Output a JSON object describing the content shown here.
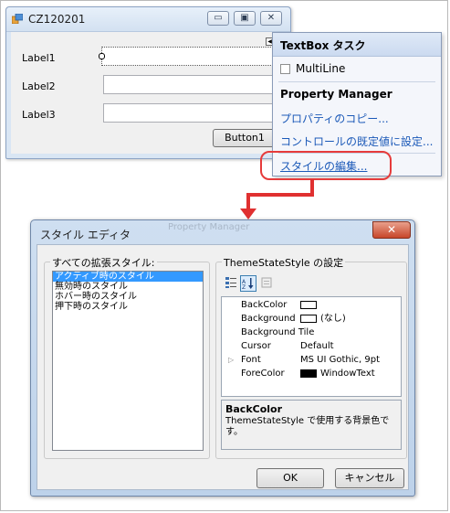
{
  "form_window": {
    "title": "CZ120201",
    "controls": {
      "minimize_glyph": "▭",
      "maximize_glyph": "▣",
      "close_glyph": "✕"
    },
    "labels": [
      "Label1",
      "Label2",
      "Label3"
    ],
    "button_label": "Button1"
  },
  "smart_tag": {
    "header": "TextBox タスク",
    "multiline_label": "MultiLine",
    "multiline_checked": false,
    "section": "Property Manager",
    "links": [
      "プロパティのコピー...",
      "コントロールの既定値に設定...",
      "スタイルの編集..."
    ]
  },
  "style_editor": {
    "title": "スタイル エディタ",
    "background_ghost_text": "Property Manager",
    "close_glyph": "✕",
    "styles_group_label": "すべての拡張スタイル:",
    "styles": [
      "アクティブ時のスタイル",
      "無効時のスタイル",
      "ホバー時のスタイル",
      "押下時のスタイル"
    ],
    "selected_style_index": 0,
    "settings_group_label": "ThemeStateStyle の設定",
    "properties": [
      {
        "name": "BackColor",
        "value": "",
        "swatch": "#ffffff",
        "expandable": false
      },
      {
        "name": "Background",
        "value": "(なし)",
        "swatch": "#ffffff",
        "expandable": false
      },
      {
        "name": "Background Tile",
        "value": "",
        "swatch": null,
        "expandable": false
      },
      {
        "name": "Cursor",
        "value": "Default",
        "swatch": null,
        "expandable": false
      },
      {
        "name": "Font",
        "value": "MS UI Gothic, 9pt",
        "swatch": null,
        "expandable": true
      },
      {
        "name": "ForeColor",
        "value": "WindowText",
        "swatch": "#000000",
        "expandable": false
      }
    ],
    "description_title": "BackColor",
    "description_text": "ThemeStateStyle で使用する背景色です。",
    "ok_label": "OK",
    "cancel_label": "キャンセル"
  },
  "colors": {
    "link": "#1b59b8",
    "callout": "#e63b3b",
    "selection": "#3399ff"
  }
}
